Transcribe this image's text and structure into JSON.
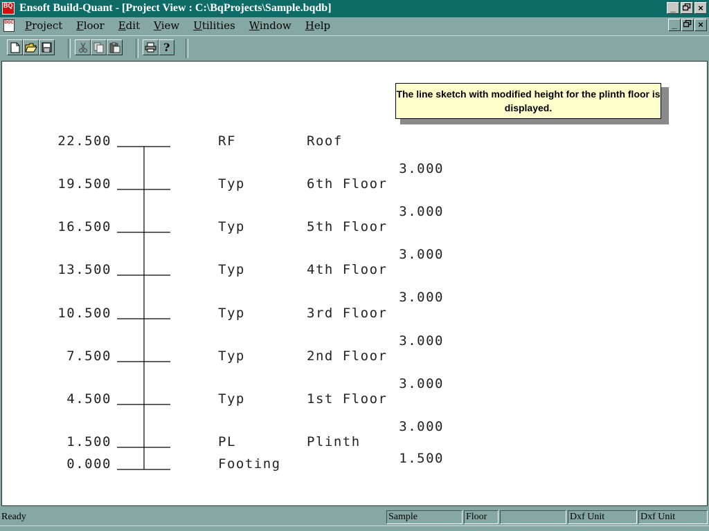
{
  "window": {
    "title": "Ensoft Build-Quant - [Project View : C:\\BqProjects\\Sample.bqdb]",
    "icon_text": "BQ",
    "minimize": "_",
    "restore": "°",
    "close": "×"
  },
  "menu": {
    "items": [
      {
        "key": "P",
        "rest": "roject"
      },
      {
        "key": "F",
        "rest": "loor"
      },
      {
        "key": "E",
        "rest": "dit"
      },
      {
        "key": "V",
        "rest": "iew"
      },
      {
        "key": "U",
        "rest": "tilities"
      },
      {
        "key": "W",
        "rest": "indow"
      },
      {
        "key": "H",
        "rest": "elp"
      }
    ],
    "doc_icon_text": "DOC"
  },
  "toolbar": {
    "icons": [
      "new-icon",
      "open-icon",
      "save-icon",
      "cut-icon",
      "copy-icon",
      "paste-icon",
      "print-icon",
      "help-icon"
    ]
  },
  "callout": {
    "text": "The line sketch with modified height for the plinth floor is displayed."
  },
  "sketch": {
    "levels": [
      {
        "elevation": "22.500",
        "type": "RF",
        "name": "Roof",
        "height": "3.000"
      },
      {
        "elevation": "19.500",
        "type": "Typ",
        "name": "6th Floor",
        "height": "3.000"
      },
      {
        "elevation": "16.500",
        "type": "Typ",
        "name": "5th Floor",
        "height": "3.000"
      },
      {
        "elevation": "13.500",
        "type": "Typ",
        "name": "4th Floor",
        "height": "3.000"
      },
      {
        "elevation": "10.500",
        "type": "Typ",
        "name": "3rd Floor",
        "height": "3.000"
      },
      {
        "elevation": "7.500",
        "type": "Typ",
        "name": "2nd Floor",
        "height": "3.000"
      },
      {
        "elevation": "4.500",
        "type": "Typ",
        "name": "1st Floor",
        "height": "3.000"
      },
      {
        "elevation": "1.500",
        "type": "PL",
        "name": "Plinth",
        "height": "1.500"
      },
      {
        "elevation": "0.000",
        "type": "Footing",
        "name": "",
        "height": ""
      }
    ]
  },
  "status": {
    "ready": "Ready",
    "project": "Sample",
    "floor": "Floor",
    "blank": "",
    "dxf1": "Dxf Unit",
    "dxf2": "Dxf Unit"
  },
  "colors": {
    "titlebar": "#0e6b68",
    "chrome": "#86a8a4",
    "callout": "#ffffcc"
  }
}
